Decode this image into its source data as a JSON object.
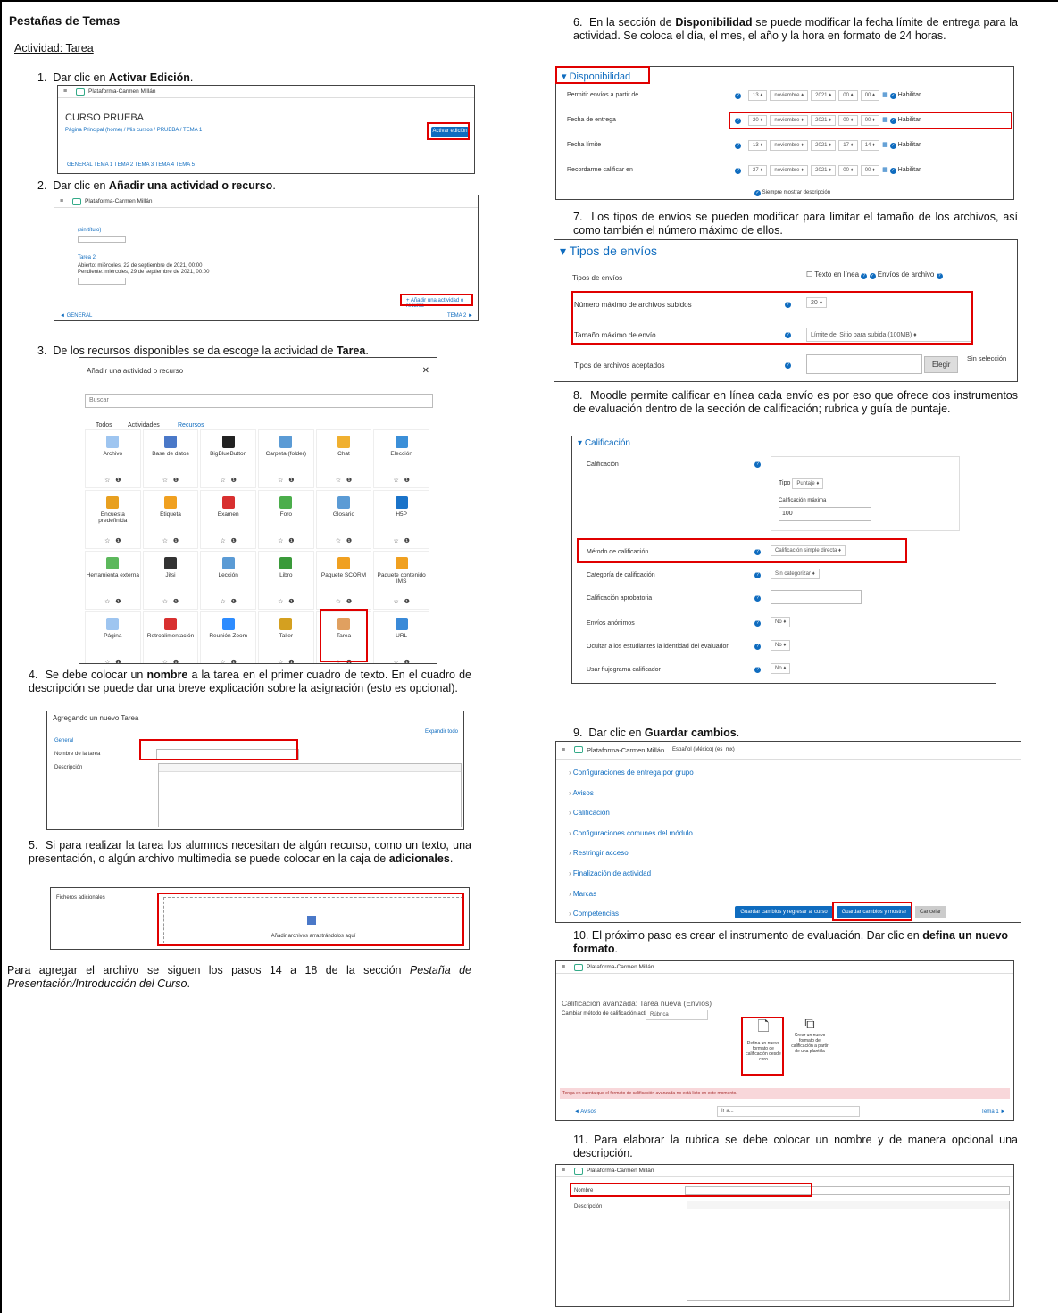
{
  "doc": {
    "title": "Pestañas de Temas",
    "subtitle": "Actividad: Tarea",
    "steps": [
      {
        "num": "1.",
        "pre": "Dar clic en ",
        "bold": "Activar Edición",
        "post": "."
      },
      {
        "num": "2.",
        "pre": "Dar clic en ",
        "bold": "Añadir una actividad o recurso",
        "post": "."
      },
      {
        "num": "3.",
        "pre": "De los recursos disponibles se da escoge la actividad de ",
        "bold": "Tarea",
        "post": "."
      },
      {
        "num": "4.",
        "pre": "Se debe colocar un ",
        "bold": "nombre",
        "post": " a la tarea en el primer cuadro de texto. En el cuadro de descripción se puede dar una breve explicación sobre la asignación (esto es opcional)."
      },
      {
        "num": "5.",
        "pre": "Si para realizar la tarea los alumnos necesitan de algún recurso, como un texto, una presentación, o algún archivo multimedia se puede colocar en la caja de ",
        "bold": "adicionales",
        "post": "."
      },
      {
        "num": "6.",
        "pre": "En la sección de ",
        "bold": "Disponibilidad",
        "post": " se puede modificar la fecha límite de entrega para la actividad. Se coloca el día, el mes, el año y la hora en formato de 24 horas."
      },
      {
        "num": "7.",
        "pre": "Los tipos de envíos se pueden modificar para limitar el tamaño de los archivos, así como también el número máximo de ellos.",
        "bold": "",
        "post": ""
      },
      {
        "num": "8.",
        "pre": "Moodle permite calificar en línea cada envío es por eso que ofrece dos instrumentos de evaluación dentro de la sección de calificación; rubrica y guía de puntaje.",
        "bold": "",
        "post": ""
      },
      {
        "num": "9.",
        "pre": "Dar clic en ",
        "bold": "Guardar cambios",
        "post": "."
      },
      {
        "num": "10.",
        "pre": "El próximo paso es crear el instrumento de evaluación. Dar clic en ",
        "bold": "defina un nuevo formato",
        "post": "."
      },
      {
        "num": "11.",
        "pre": "Para elaborar la rubrica se debe colocar un nombre y de manera opcional una descripción.",
        "bold": "",
        "post": ""
      }
    ],
    "footer_pre": "Para agregar el archivo se siguen los pasos 14 a 18 de la sección ",
    "footer_italic": "Pestaña de Presentación/Introducción del Curso",
    "footer_post": "."
  },
  "s1": {
    "brand": "Plataforma-Carmen Millán",
    "course": "CURSO PRUEBA",
    "crumb": "Página Principal (home) / Mis cursos / PRUEBA / TEMA 1",
    "button": "Activar edición",
    "tabs": "GENERAL  TEMA 1  TEMA 2  TEMA 3  TEMA 4  TEMA 5"
  },
  "s2": {
    "brand": "Plataforma-Carmen Millán",
    "item1": "(sin título)",
    "item2": "Tarea 2",
    "due1": "Abierto: miércoles, 22 de septiembre de 2021, 00:00",
    "due2": "Pendiente: miércoles, 29 de septiembre de 2021, 00:00",
    "add": "+ Añadir una actividad o recurso",
    "prev": "◄ GENERAL",
    "next": "TEMA 2 ►"
  },
  "s3": {
    "title": "Añadir una actividad o recurso",
    "search": "Buscar",
    "tabs": [
      "Todos",
      "Actividades",
      "Recursos"
    ],
    "items": [
      {
        "label": "Archivo",
        "color": "#9ec5f0"
      },
      {
        "label": "Base de datos",
        "color": "#4a78c8"
      },
      {
        "label": "BigBlueButton",
        "color": "#222"
      },
      {
        "label": "Carpeta (folder)",
        "color": "#5b9bd5"
      },
      {
        "label": "Chat",
        "color": "#f0b030"
      },
      {
        "label": "Elección",
        "color": "#3b8fd8"
      },
      {
        "label": "Encuesta predefinida",
        "color": "#e8a020"
      },
      {
        "label": "Etiqueta",
        "color": "#f0a020"
      },
      {
        "label": "Examen",
        "color": "#d83030"
      },
      {
        "label": "Foro",
        "color": "#4cae4c"
      },
      {
        "label": "Glosario",
        "color": "#5b9bd5"
      },
      {
        "label": "H5P",
        "color": "#1a73c9"
      },
      {
        "label": "Herramienta externa",
        "color": "#5cb85c"
      },
      {
        "label": "Jitsi",
        "color": "#333"
      },
      {
        "label": "Lección",
        "color": "#5b9bd5"
      },
      {
        "label": "Libro",
        "color": "#3a9a3a"
      },
      {
        "label": "Paquete SCORM",
        "color": "#f0a020"
      },
      {
        "label": "Paquete contenido IMS",
        "color": "#f0a020"
      },
      {
        "label": "Página",
        "color": "#9ec5f0"
      },
      {
        "label": "Retroalimentación",
        "color": "#d83030"
      },
      {
        "label": "Reunión Zoom",
        "color": "#2d8cff"
      },
      {
        "label": "Taller",
        "color": "#d4a020"
      },
      {
        "label": "Tarea",
        "color": "#e0a060"
      },
      {
        "label": "URL",
        "color": "#3a8ad8"
      }
    ]
  },
  "s4": {
    "header": "Agregando un nuevo Tarea",
    "section": "General",
    "name_label": "Nombre de la tarea",
    "desc_label": "Descripción",
    "expand": "Expandir todo"
  },
  "s5": {
    "label": "Ficheros adicionales",
    "hint": "Añadir archivos arrastrándolos aquí"
  },
  "s6": {
    "header": "Disponibilidad",
    "rows": [
      {
        "label": "Permitir envíos a partir de",
        "vals": [
          "13",
          "noviembre",
          "2021",
          "00",
          "00"
        ],
        "check": "Habilitar"
      },
      {
        "label": "Fecha de entrega",
        "vals": [
          "20",
          "noviembre",
          "2021",
          "00",
          "00"
        ],
        "check": "Habilitar"
      },
      {
        "label": "Fecha límite",
        "vals": [
          "13",
          "noviembre",
          "2021",
          "17",
          "14"
        ],
        "check": "Habilitar"
      },
      {
        "label": "Recordarme calificar en",
        "vals": [
          "27",
          "noviembre",
          "2021",
          "00",
          "00"
        ],
        "check": "Habilitar"
      }
    ],
    "always": "Siempre mostrar descripción"
  },
  "s7": {
    "header": "Tipos de envíos",
    "types_label": "Tipos de envíos",
    "opt1": "Texto en línea",
    "opt2": "Envíos de archivo",
    "max_label": "Número máximo de archivos subidos",
    "max_val": "20",
    "size_label": "Tamaño máximo de envío",
    "size_val": "Límite del Sitio para subida (100MB)",
    "accept_label": "Tipos de archivos aceptados",
    "choose": "Elegir",
    "nosel": "Sin selección"
  },
  "s8": {
    "header": "Calificación",
    "grade_label": "Calificación",
    "type_label": "Tipo",
    "type_val": "Puntaje",
    "max_label": "Calificación máxima",
    "max_val": "100",
    "method_label": "Método de calificación",
    "method_val": "Calificación simple directa",
    "cat_label": "Categoría de calificación",
    "cat_val": "Sin categorizar",
    "pass_label": "Calificación aprobatoria",
    "anon_label": "Envíos anónimos",
    "anon_val": "No",
    "hide_label": "Ocultar a los estudiantes la identidad del evaluador",
    "hide_val": "No",
    "flow_label": "Usar flujograma calificador",
    "flow_val": "No"
  },
  "s9": {
    "brand": "Plataforma-Carmen Millán",
    "lang": "Español (México) (es_mx)",
    "items": [
      "Configuraciones de entrega por grupo",
      "Avisos",
      "Calificación",
      "Configuraciones comunes del módulo",
      "Restringir acceso",
      "Finalización de actividad",
      "Marcas",
      "Competencias"
    ],
    "btn1": "Guardar cambios y regresar al curso",
    "btn2": "Guardar cambios y mostrar",
    "btn3": "Cancelar"
  },
  "s10": {
    "brand": "Plataforma-Carmen Millán",
    "title": "Calificación avanzada: Tarea nueva (Envíos)",
    "method_label": "Cambiar método de calificación activo a",
    "method_val": "Rúbrica",
    "new": "Defina un nuevo formato de calificación desde cero",
    "tpl": "Crear un nuevo formato de calificación a partir de una plantilla",
    "warn": "Tenga en cuenta que el formato de calificación avanzada no está listo en este momento.",
    "prev": "◄ Avisos",
    "next": "Tema 1 ►"
  },
  "s11": {
    "brand": "Plataforma-Carmen Millán",
    "name_label": "Nombre",
    "desc_label": "Descripción"
  }
}
